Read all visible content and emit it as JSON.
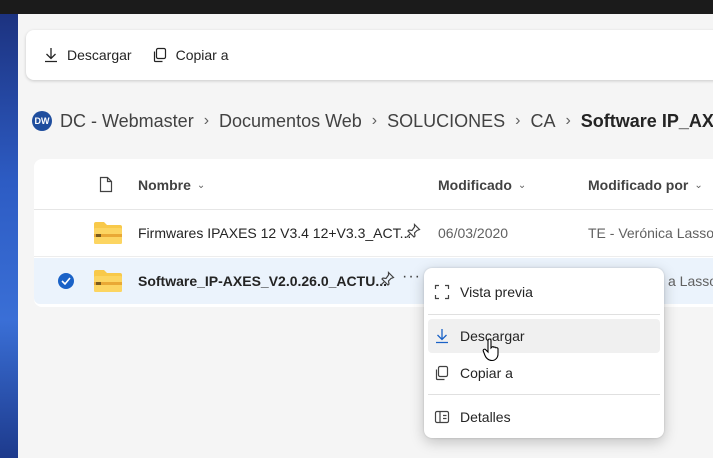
{
  "command_bar": {
    "download_label": "Descargar",
    "copy_label": "Copiar a"
  },
  "breadcrumb": {
    "avatar_initials": "DW",
    "items": [
      "DC - Webmaster",
      "Documentos Web",
      "SOLUCIONES",
      "CA"
    ],
    "current": "Software IP_AXES"
  },
  "list": {
    "columns": {
      "name": "Nombre",
      "modified": "Modificado",
      "modified_by": "Modificado por"
    },
    "rows": [
      {
        "name": "Firmwares IPAXES 12 V3.4 12+V3.3_ACT...",
        "modified": "06/03/2020",
        "modified_by": "TE - Verónica Lasso",
        "selected": false
      },
      {
        "name": "Software_IP-AXES_V2.0.26.0_ACTU...",
        "modified_by_visible": "a Lasso",
        "selected": true
      }
    ]
  },
  "context_menu": {
    "preview_label": "Vista previa",
    "download_label": "Descargar",
    "copy_label": "Copiar a",
    "details_label": "Detalles",
    "hovered_item": "Descargar"
  },
  "colors": {
    "accent": "#1a62c7",
    "selected_row": "#ebf3fc",
    "folder_yellow": "#f8c94a"
  },
  "icons": [
    "download-icon",
    "copy-icon",
    "file-icon",
    "folder-zip-icon",
    "pin-icon",
    "checkmark-icon",
    "more-icon",
    "preview-icon",
    "details-icon",
    "hand-cursor-icon"
  ]
}
